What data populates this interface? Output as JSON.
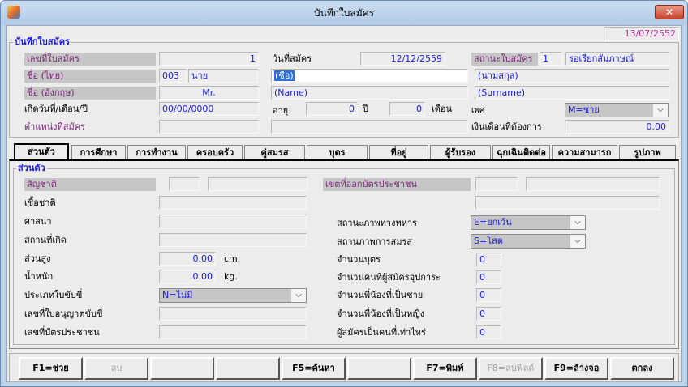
{
  "window": {
    "title": "บันทึกใบสมัคร",
    "close": "✕"
  },
  "header": {
    "date": "13/07/2552",
    "group_title": "บันทึกใบสมัคร",
    "app_no_label": "เลขที่ใบสมัคร",
    "app_no_value": "1",
    "app_date_label": "วันที่สมัคร",
    "app_date_value": "12/12/2559",
    "status_label": "สถานะใบสมัคร",
    "status_code": "1",
    "status_text": "รอเรียกสัมภาษณ์",
    "name_th_label": "ชื่อ (ไทย)",
    "title_code": "003",
    "title_th": "นาย",
    "first_name_th": "(ชื่อ)",
    "last_name_th": "(นามสกุล)",
    "name_en_label": "ชื่อ (อังกฤษ)",
    "title_en": "Mr.",
    "first_name_en": "(Name)",
    "last_name_en": "(Surname)",
    "birth_label": "เกิดวันที่/เดือน/ปี",
    "birth_value": "00/00/0000",
    "age_label": "อายุ",
    "age_years": "0",
    "years_unit": "ปี",
    "age_months": "0",
    "months_unit": "เดือน",
    "sex_label": "เพศ",
    "sex_value": "M=ชาย",
    "position_label": "ตำแหน่งที่สมัคร",
    "salary_label": "เงินเดือนที่ต้องการ",
    "salary_value": "0.00"
  },
  "tabs": [
    "ส่วนตัว",
    "การศึกษา",
    "การทำงาน",
    "ครอบครัว",
    "คู่สมรส",
    "บุตร",
    "ที่อยู่",
    "ผู้รับรอง",
    "ฉุกเฉินติดต่อ",
    "ความสามารถ",
    "รูปภาพ"
  ],
  "personal": {
    "group_title": "ส่วนตัว",
    "nationality_label": "สัญชาติ",
    "race_label": "เชื้อชาติ",
    "religion_label": "ศาสนา",
    "birthplace_label": "สถานที่เกิด",
    "height_label": "ส่วนสูง",
    "height_value": "0.00",
    "height_unit": "cm.",
    "weight_label": "น้ำหนัก",
    "weight_value": "0.00",
    "weight_unit": "kg.",
    "license_type_label": "ประเภทใบขับขี่",
    "license_type_value": "N=ไม่มี",
    "license_no_label": "เลขที่ใบอนุญาตขับขี่",
    "id_no_label": "เลขที่บัตรประชาชน",
    "id_district_label": "เขตที่ออกบัตรประชาชน",
    "military_label": "สถานะภาพทางทหาร",
    "military_value": "E=ยกเว้น",
    "marital_label": "สถานภาพการสมรส",
    "marital_value": "S=โสด",
    "children_label": "จำนวนบุตร",
    "children_value": "0",
    "dependents_label": "จำนวนคนที่ผู้สมัครอุปการะ",
    "dependents_value": "0",
    "brothers_label": "จำนวนพี่น้องที่เป็นชาย",
    "brothers_value": "0",
    "sisters_label": "จำนวนพี่น้องที่เป็นหญิง",
    "sisters_value": "0",
    "birth_order_label": "ผู้สมัครเป็นคนที่เท่าไหร่",
    "birth_order_value": "0"
  },
  "buttons": [
    "F1=ช่วย",
    "ลบ",
    "",
    "",
    "F5=ค้นหา",
    "",
    "F7=พิมพ์",
    "F8=ลบฟิลด์",
    "F9=ล้างจอ",
    "ตกลง"
  ]
}
